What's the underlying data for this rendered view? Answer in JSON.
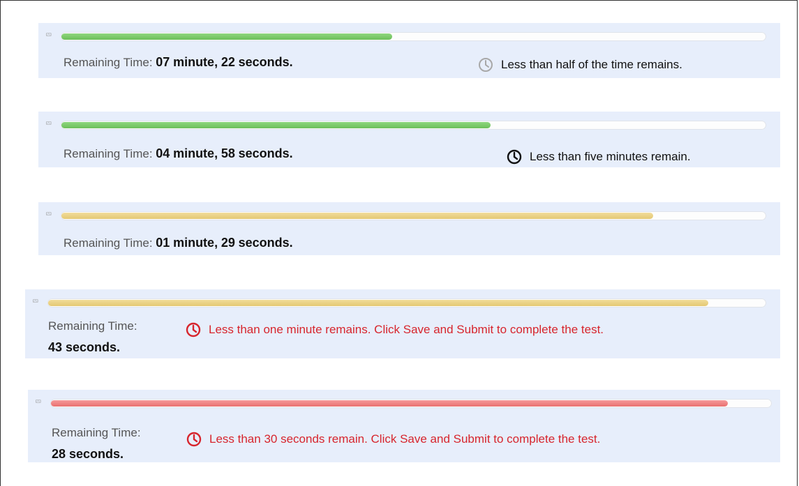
{
  "colors": {
    "panel_bg": "#e7eefb",
    "progress_green": "#6cbf59",
    "progress_yellow": "#e4c873",
    "progress_red": "#e97070",
    "warning_red": "#d7252d"
  },
  "timers": [
    {
      "progress": 0.47,
      "bar_color": "green",
      "label": "Remaining Time:",
      "minutes": "07",
      "minute_unit": "minute,",
      "seconds": "22",
      "second_unit": "seconds.",
      "icon": "clock-icon",
      "message": "Less than half of the time remains."
    },
    {
      "progress": 0.61,
      "bar_color": "green",
      "label": "Remaining Time:",
      "minutes": "04",
      "minute_unit": "minute,",
      "seconds": "58",
      "second_unit": "seconds.",
      "icon": "clock-icon",
      "message": "Less than five minutes remain."
    },
    {
      "progress": 0.84,
      "bar_color": "yellow",
      "label": "Remaining Time:",
      "minutes": "01",
      "minute_unit": "minute,",
      "seconds": "29",
      "second_unit": "seconds."
    },
    {
      "progress": 0.92,
      "bar_color": "yellow",
      "label": "Remaining Time:",
      "seconds_text": "43 seconds.",
      "icon": "clock-icon",
      "message": "Less than one minute remains. Click Save and Submit to complete the test."
    },
    {
      "progress": 0.94,
      "bar_color": "red",
      "label": "Remaining Time:",
      "seconds_text": "28 seconds.",
      "icon": "clock-icon",
      "message": "Less than 30 seconds remain. Click Save and Submit to complete the test."
    }
  ]
}
